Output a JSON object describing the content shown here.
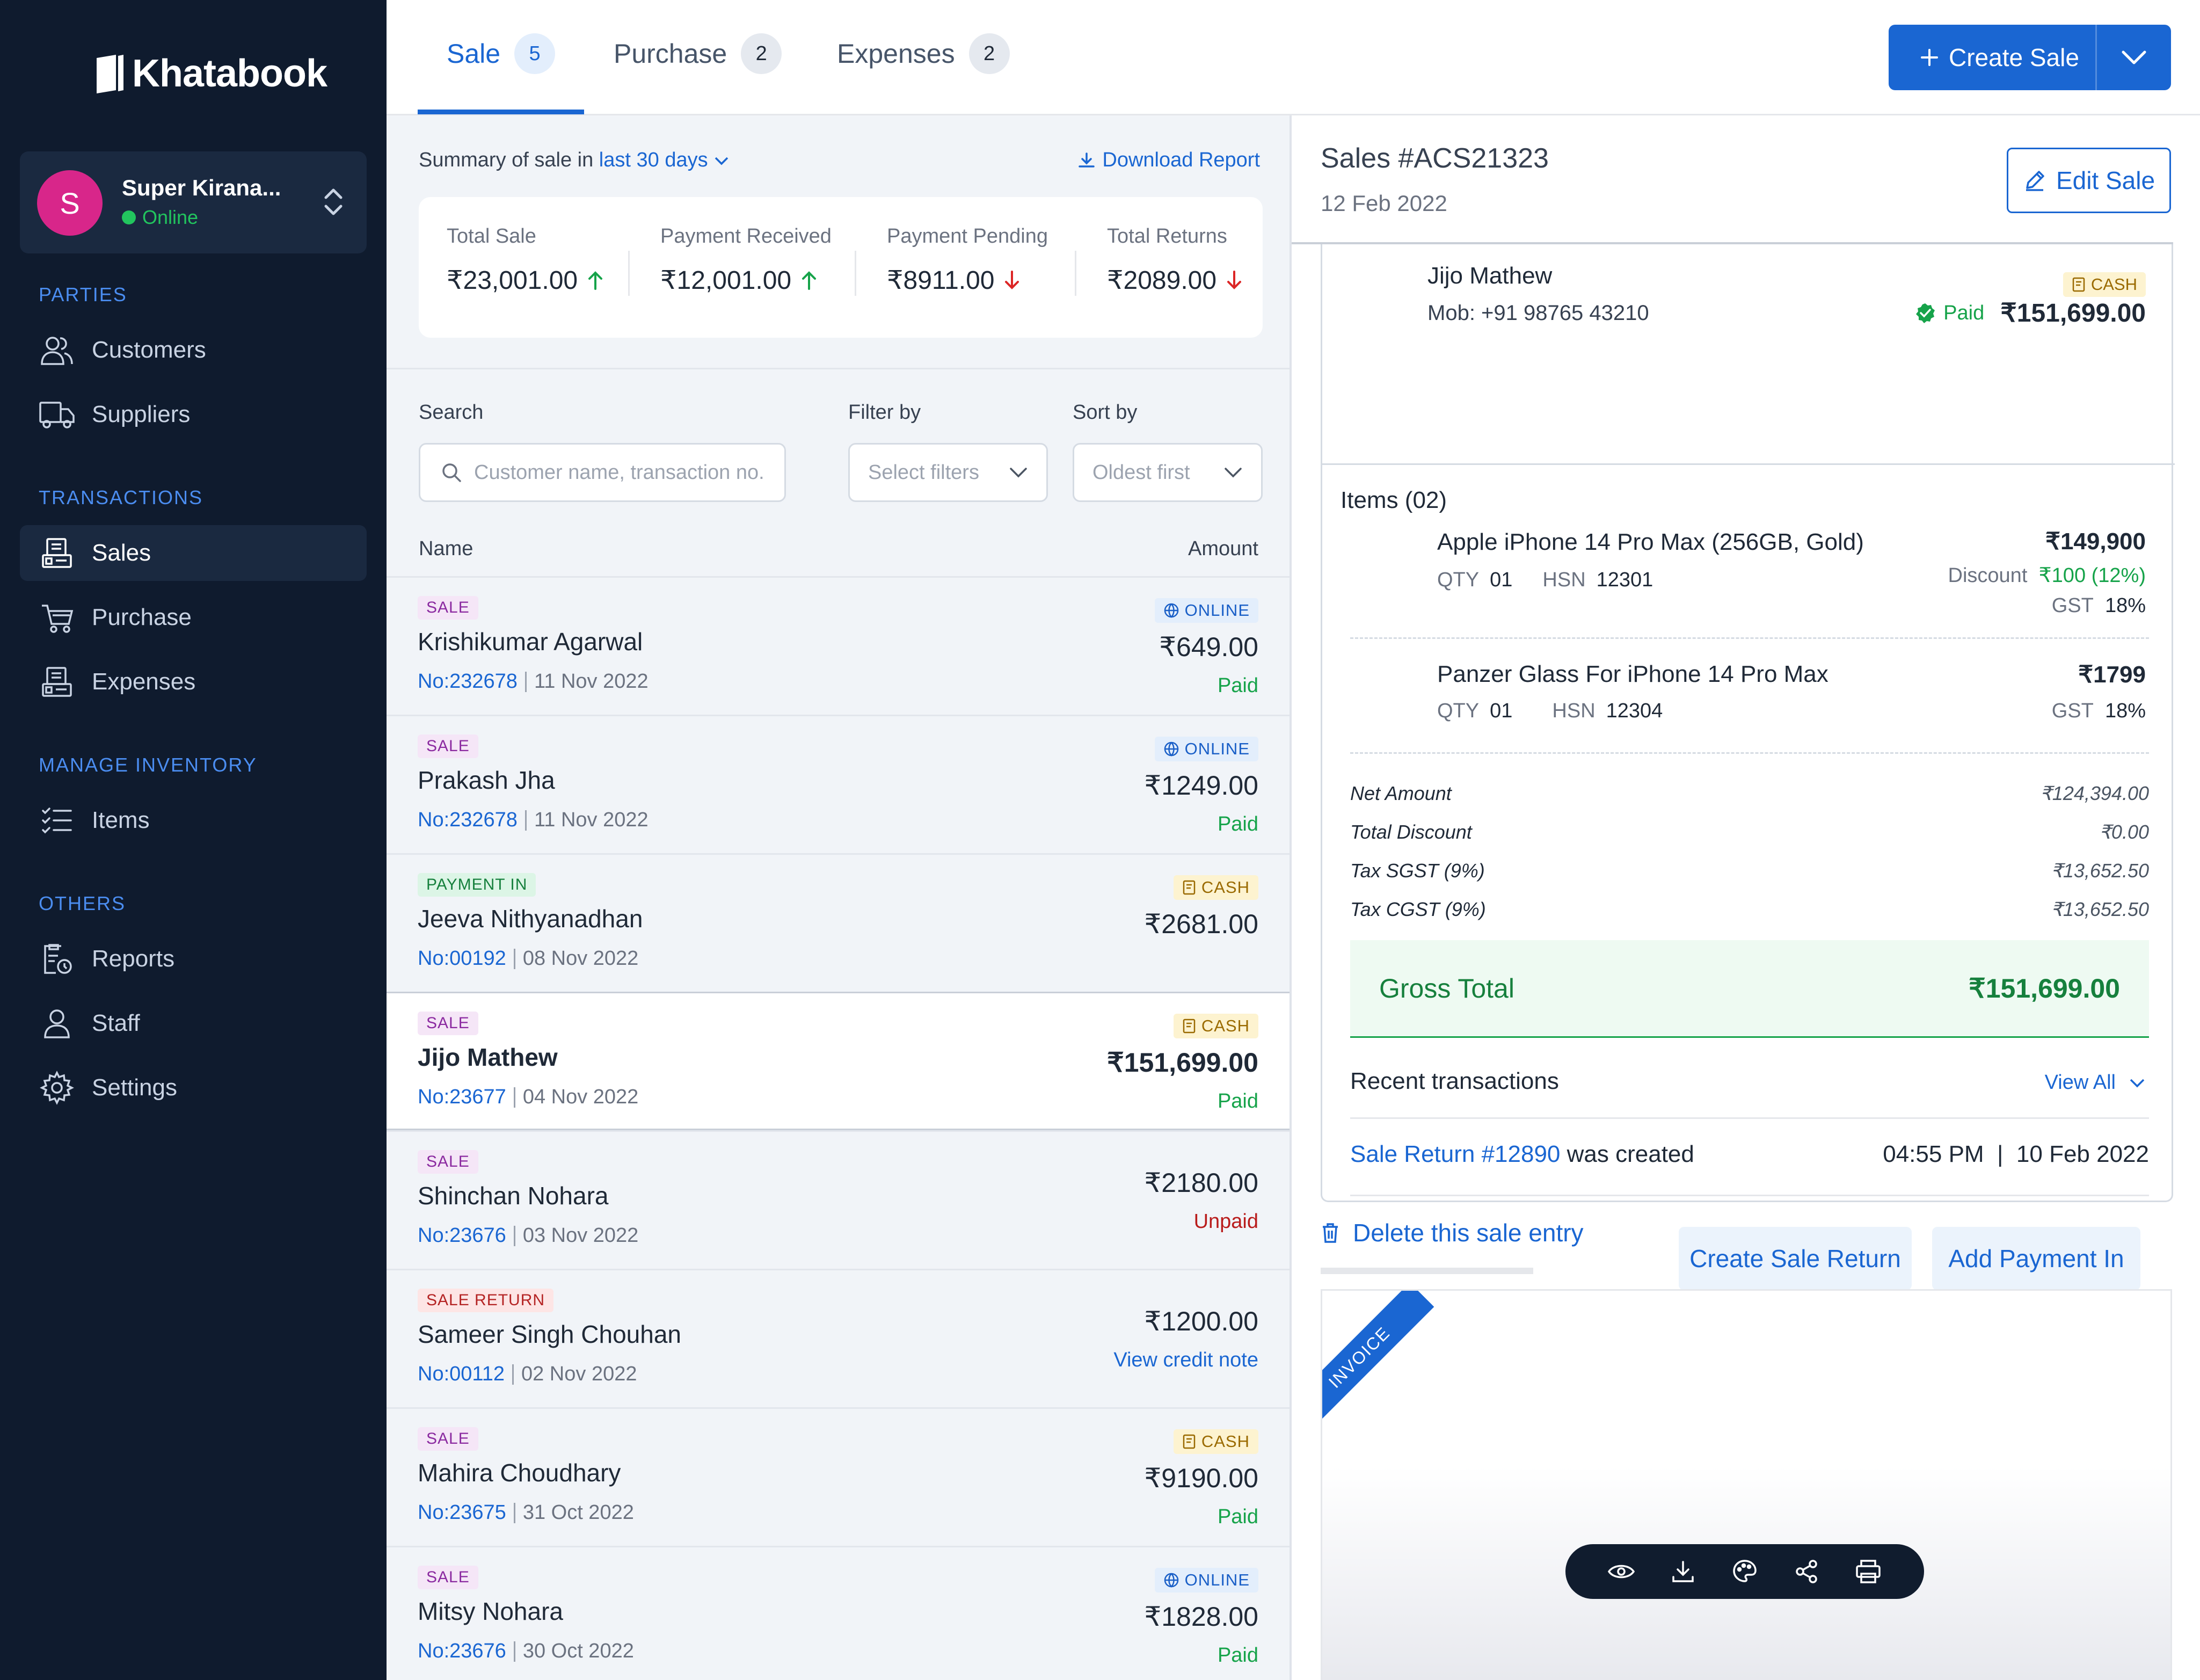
{
  "app": {
    "name": "Khatabook"
  },
  "store": {
    "initial": "S",
    "name": "Super Kirana...",
    "status": "Online"
  },
  "sidebar": {
    "sections": {
      "parties": "PARTIES",
      "transactions": "TRANSACTIONS",
      "inventory": "MANAGE INVENTORY",
      "others": "OTHERS"
    },
    "items": {
      "customers": "Customers",
      "suppliers": "Suppliers",
      "sales": "Sales",
      "purchase": "Purchase",
      "expenses": "Expenses",
      "items": "Items",
      "reports": "Reports",
      "staff": "Staff",
      "settings": "Settings"
    },
    "active": "sales"
  },
  "tabs": [
    {
      "label": "Sale",
      "count": "5"
    },
    {
      "label": "Purchase",
      "count": "2"
    },
    {
      "label": "Expenses",
      "count": "2"
    }
  ],
  "header": {
    "create_label": "Create Sale"
  },
  "summary": {
    "prefix": "Summary of sale in",
    "period": "last 30 days",
    "download": "Download Report",
    "stats": [
      {
        "label": "Total Sale",
        "value": "₹23,001.00",
        "trend": "up"
      },
      {
        "label": "Payment Received",
        "value": "₹12,001.00",
        "trend": "up"
      },
      {
        "label": "Payment Pending",
        "value": "₹8911.00",
        "trend": "down"
      },
      {
        "label": "Total Returns",
        "value": "₹2089.00",
        "trend": "down"
      }
    ]
  },
  "filters": {
    "search_label": "Search",
    "search_placeholder": "Customer name, transaction no.",
    "filter_label": "Filter by",
    "filter_value": "Select filters",
    "sort_label": "Sort by",
    "sort_value": "Oldest first"
  },
  "list": {
    "col_name": "Name",
    "col_amount": "Amount",
    "rows": [
      {
        "tag": "SALE",
        "name": "Krishikumar Agarwal",
        "no": "No:232678",
        "date": "11 Nov 2022",
        "badge": "ONLINE",
        "amount": "₹649.00",
        "status": "Paid"
      },
      {
        "tag": "SALE",
        "name": "Prakash Jha",
        "no": "No:232678",
        "date": "11 Nov 2022",
        "badge": "ONLINE",
        "amount": "₹1249.00",
        "status": "Paid"
      },
      {
        "tag": "PAYMENT IN",
        "name": "Jeeva Nithyanadhan",
        "no": "No:00192",
        "date": "08 Nov 2022",
        "badge": "CASH",
        "amount": "₹2681.00",
        "status": ""
      },
      {
        "tag": "SALE",
        "name": "Jijo Mathew",
        "no": "No:23677",
        "date": "04 Nov 2022",
        "badge": "CASH",
        "amount": "₹151,699.00",
        "status": "Paid"
      },
      {
        "tag": "SALE",
        "name": "Shinchan Nohara",
        "no": "No:23676",
        "date": "03 Nov 2022",
        "badge": "",
        "amount": "₹2180.00",
        "status": "Unpaid"
      },
      {
        "tag": "SALE RETURN",
        "name": "Sameer Singh Chouhan",
        "no": "No:00112",
        "date": "02 Nov 2022",
        "badge": "",
        "amount": "₹1200.00",
        "status": "View credit note"
      },
      {
        "tag": "SALE",
        "name": "Mahira Choudhary",
        "no": "No:23675",
        "date": "31 Oct 2022",
        "badge": "CASH",
        "amount": "₹9190.00",
        "status": "Paid"
      },
      {
        "tag": "SALE",
        "name": "Mitsy Nohara",
        "no": "No:23676",
        "date": "30 Oct 2022",
        "badge": "ONLINE",
        "amount": "₹1828.00",
        "status": "Paid"
      }
    ]
  },
  "detail": {
    "title": "Sales #ACS21323",
    "date": "12 Feb 2022",
    "edit_label": "Edit Sale",
    "customer": {
      "name": "Jijo Mathew",
      "mobile": "Mob: +91 98765 43210",
      "badge": "CASH",
      "status": "Paid",
      "amount": "₹151,699.00"
    },
    "items_heading": "Items (02)",
    "items": [
      {
        "name": "Apple iPhone 14 Pro Max (256GB, Gold)",
        "qty_label": "QTY",
        "qty": "01",
        "hsn_label": "HSN",
        "hsn": "12301",
        "price": "₹149,900",
        "discount_label": "Discount",
        "discount": "₹100 (12%)",
        "gst_label": "GST",
        "gst": "18%"
      },
      {
        "name": "Panzer Glass For iPhone 14 Pro Max",
        "qty_label": "QTY",
        "qty": "01",
        "hsn_label": "HSN",
        "hsn": "12304",
        "price": "₹1799",
        "gst_label": "GST",
        "gst": "18%"
      }
    ],
    "totals": [
      {
        "label": "Net Amount",
        "value": "₹124,394.00"
      },
      {
        "label": "Total  Discount",
        "value": "₹0.00"
      },
      {
        "label": "Tax SGST (9%)",
        "value": "₹13,652.50"
      },
      {
        "label": "Tax CGST (9%)",
        "value": "₹13,652.50"
      }
    ],
    "gross_label": "Gross Total",
    "gross_value": "₹151,699.00",
    "recent_heading": "Recent transactions",
    "view_all": "View All",
    "recent": {
      "link": "Sale Return #12890",
      "text": "was created",
      "time": "04:55 PM",
      "date": "10 Feb 2022"
    },
    "create_return": "Create Sale Return",
    "add_payment": "Add Payment In",
    "delete_label": "Delete this sale entry",
    "ribbon": "INVOICE"
  },
  "colors": {
    "primary": "#1a66d2",
    "sidebar": "#0f1b2e",
    "paid": "#16a34a",
    "unpaid": "#b91c1c"
  }
}
